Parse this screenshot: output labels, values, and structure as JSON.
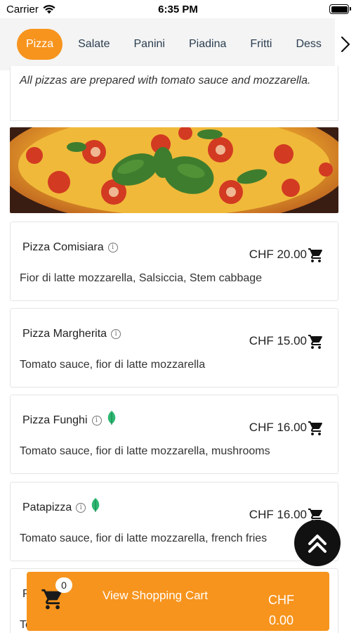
{
  "status_bar": {
    "carrier": "Carrier",
    "time": "6:35 PM"
  },
  "categories": {
    "tabs": [
      {
        "label": "Pizza",
        "active": true
      },
      {
        "label": "Salate"
      },
      {
        "label": "Panini"
      },
      {
        "label": "Piadina"
      },
      {
        "label": "Fritti"
      },
      {
        "label": "Dess"
      }
    ],
    "accent_color": "#f7941d"
  },
  "section": {
    "note": "All pizzas are prepared with tomato sauce and mozzarella."
  },
  "items": [
    {
      "name": "Pizza Comisiara",
      "price": "CHF 20.00",
      "description": "Fior di latte mozzarella, Salsiccia, Stem cabbage",
      "vegetarian": false
    },
    {
      "name": "Pizza Margherita",
      "price": "CHF 15.00",
      "description": "Tomato sauce, fior di latte mozzarella",
      "vegetarian": false
    },
    {
      "name": "Pizza Funghi",
      "price": "CHF 16.00",
      "description": "Tomato sauce, fior di latte mozzarella, mushrooms",
      "vegetarian": true
    },
    {
      "name": "Patapizza",
      "price": "CHF 16.00",
      "description": "Tomato sauce, fior di latte mozzarella, french fries",
      "vegetarian": true
    },
    {
      "name": "P",
      "price": "",
      "description": "To",
      "vegetarian": false
    }
  ],
  "cart": {
    "count": "0",
    "label": "View Shopping Cart",
    "currency": "CHF",
    "total": "0.00"
  }
}
